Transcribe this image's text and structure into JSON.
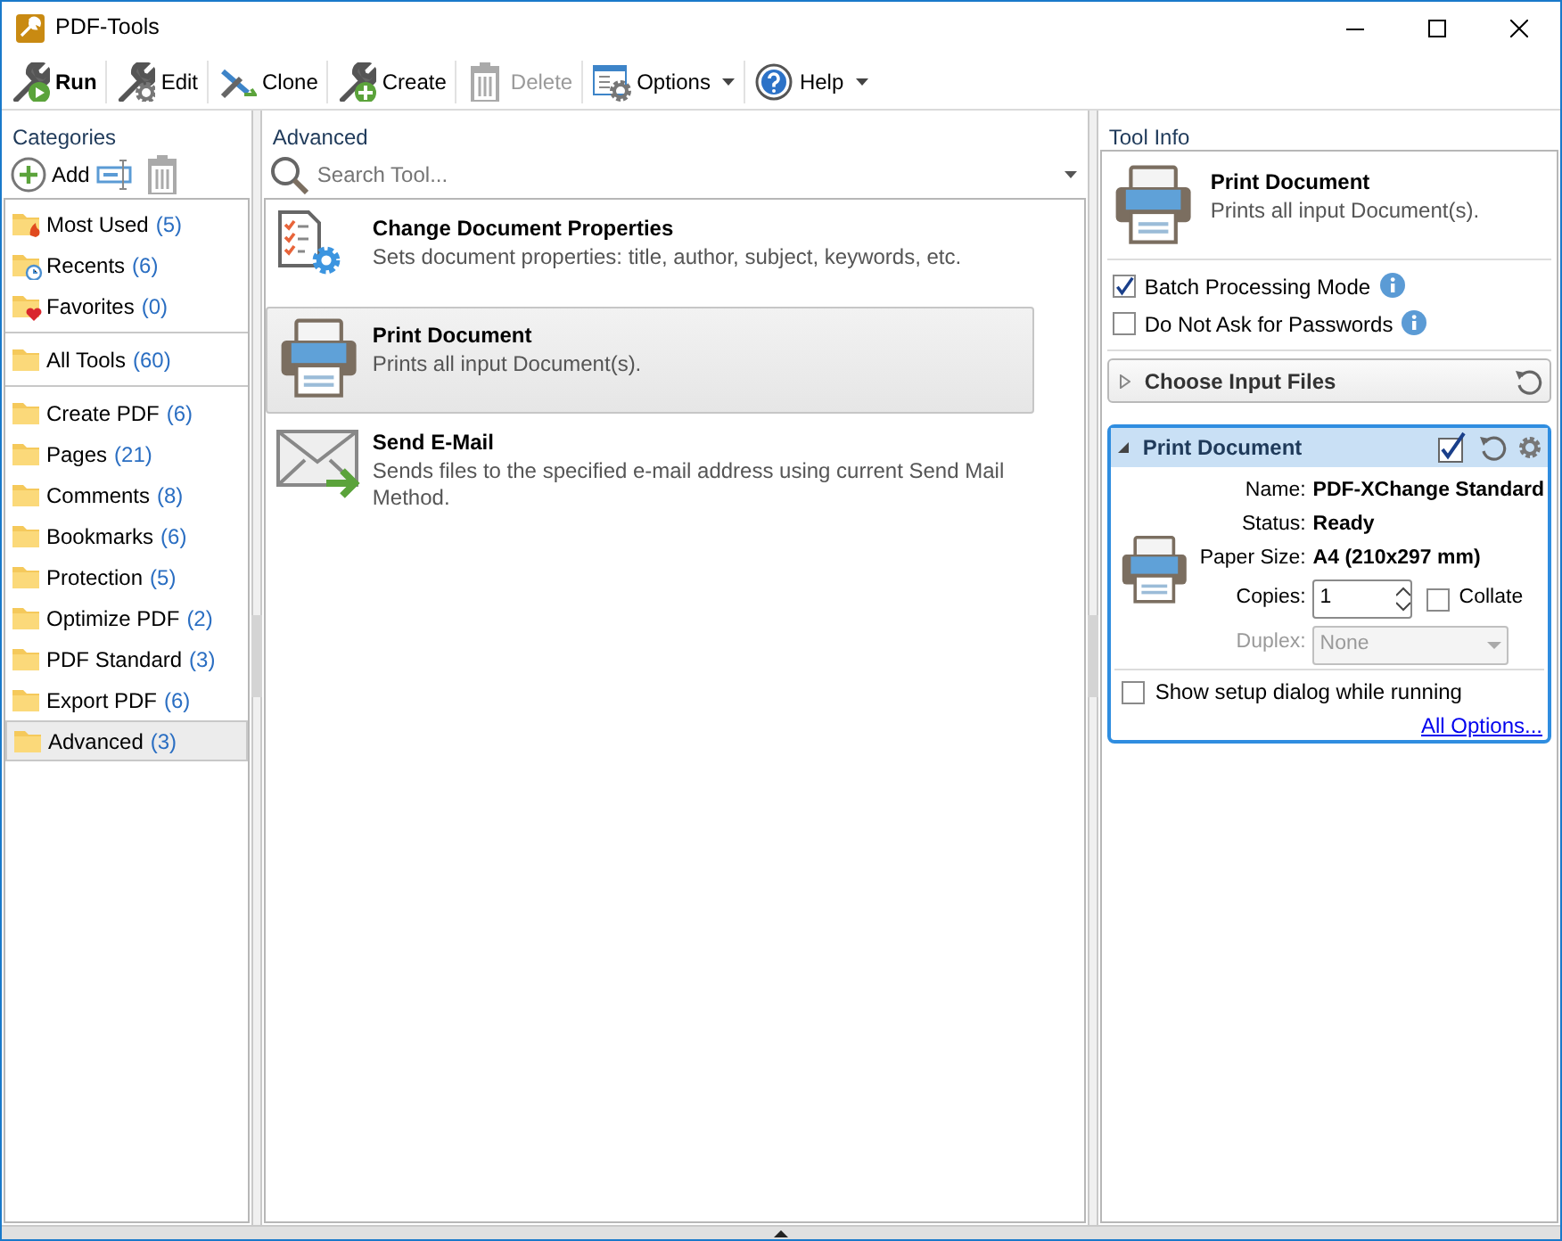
{
  "window": {
    "title": "PDF-Tools"
  },
  "toolbar": [
    {
      "label": "Run",
      "default": true,
      "disabled": false,
      "dropdown": false
    },
    {
      "label": "Edit",
      "default": false,
      "disabled": false,
      "dropdown": false
    },
    {
      "label": "Clone",
      "default": false,
      "disabled": false,
      "dropdown": false
    },
    {
      "label": "Create",
      "default": false,
      "disabled": false,
      "dropdown": false
    },
    {
      "label": "Delete",
      "default": false,
      "disabled": true,
      "dropdown": false
    },
    {
      "label": "Options",
      "default": false,
      "disabled": false,
      "dropdown": true
    },
    {
      "label": "Help",
      "default": false,
      "disabled": false,
      "dropdown": true
    }
  ],
  "categories": {
    "title": "Categories",
    "add_label": "Add",
    "groups": [
      [
        {
          "name": "Most Used",
          "count": "(5)",
          "kind": "hot",
          "selected": false
        },
        {
          "name": "Recents",
          "count": "(6)",
          "kind": "recent",
          "selected": false
        },
        {
          "name": "Favorites",
          "count": "(0)",
          "kind": "favorite",
          "selected": false
        }
      ],
      [
        {
          "name": "All Tools",
          "count": "(60)",
          "kind": "folder",
          "selected": false
        }
      ],
      [
        {
          "name": "Create PDF",
          "count": "(6)",
          "kind": "folder",
          "selected": false
        },
        {
          "name": "Pages",
          "count": "(21)",
          "kind": "folder",
          "selected": false
        },
        {
          "name": "Comments",
          "count": "(8)",
          "kind": "folder",
          "selected": false
        },
        {
          "name": "Bookmarks",
          "count": "(6)",
          "kind": "folder",
          "selected": false
        },
        {
          "name": "Protection",
          "count": "(5)",
          "kind": "folder",
          "selected": false
        },
        {
          "name": "Optimize PDF",
          "count": "(2)",
          "kind": "folder",
          "selected": false
        },
        {
          "name": "PDF Standard",
          "count": "(3)",
          "kind": "folder",
          "selected": false
        },
        {
          "name": "Export PDF",
          "count": "(6)",
          "kind": "folder",
          "selected": false
        },
        {
          "name": "Advanced",
          "count": "(3)",
          "kind": "folder",
          "selected": true
        }
      ]
    ]
  },
  "tools": {
    "title": "Advanced",
    "search": {
      "placeholder": "Search Tool..."
    },
    "items": [
      {
        "title": "Change Document Properties",
        "description": "Sets document properties: title, author, subject, keywords, etc.",
        "kind": "properties",
        "selected": false
      },
      {
        "title": "Print Document",
        "description": "Prints all input Document(s).",
        "kind": "print",
        "selected": true
      },
      {
        "title": "Send E-Mail",
        "description": "Sends files to the specified e-mail address using current Send Mail Method.",
        "kind": "email",
        "selected": false
      }
    ]
  },
  "tool_info": {
    "title": "Tool Info",
    "tool_title": "Print Document",
    "tool_description": "Prints all input Document(s).",
    "options": [
      {
        "label": "Batch Processing Mode",
        "checked": true
      },
      {
        "label": "Do Not Ask for Passwords",
        "checked": false
      }
    ],
    "input_section": {
      "title": "Choose Input Files",
      "expanded": false
    },
    "print_section": {
      "title": "Print Document",
      "expanded": true,
      "fields": [
        {
          "label": "Name:",
          "value": "PDF-XChange Standard",
          "kind": "text",
          "disabled": false
        },
        {
          "label": "Status:",
          "value": "Ready",
          "kind": "text",
          "disabled": false
        },
        {
          "label": "Paper Size:",
          "value": "A4 (210x297 mm)",
          "kind": "text",
          "disabled": false
        },
        {
          "label": "Copies:",
          "value": "1",
          "kind": "spin",
          "disabled": false
        },
        {
          "label": "Duplex:",
          "value": "None",
          "kind": "select",
          "disabled": true
        }
      ],
      "collate": {
        "label": "Collate",
        "checked": false
      },
      "setup_dialog": {
        "label": "Show setup dialog while running",
        "checked": false
      },
      "link": "All Options..."
    }
  }
}
